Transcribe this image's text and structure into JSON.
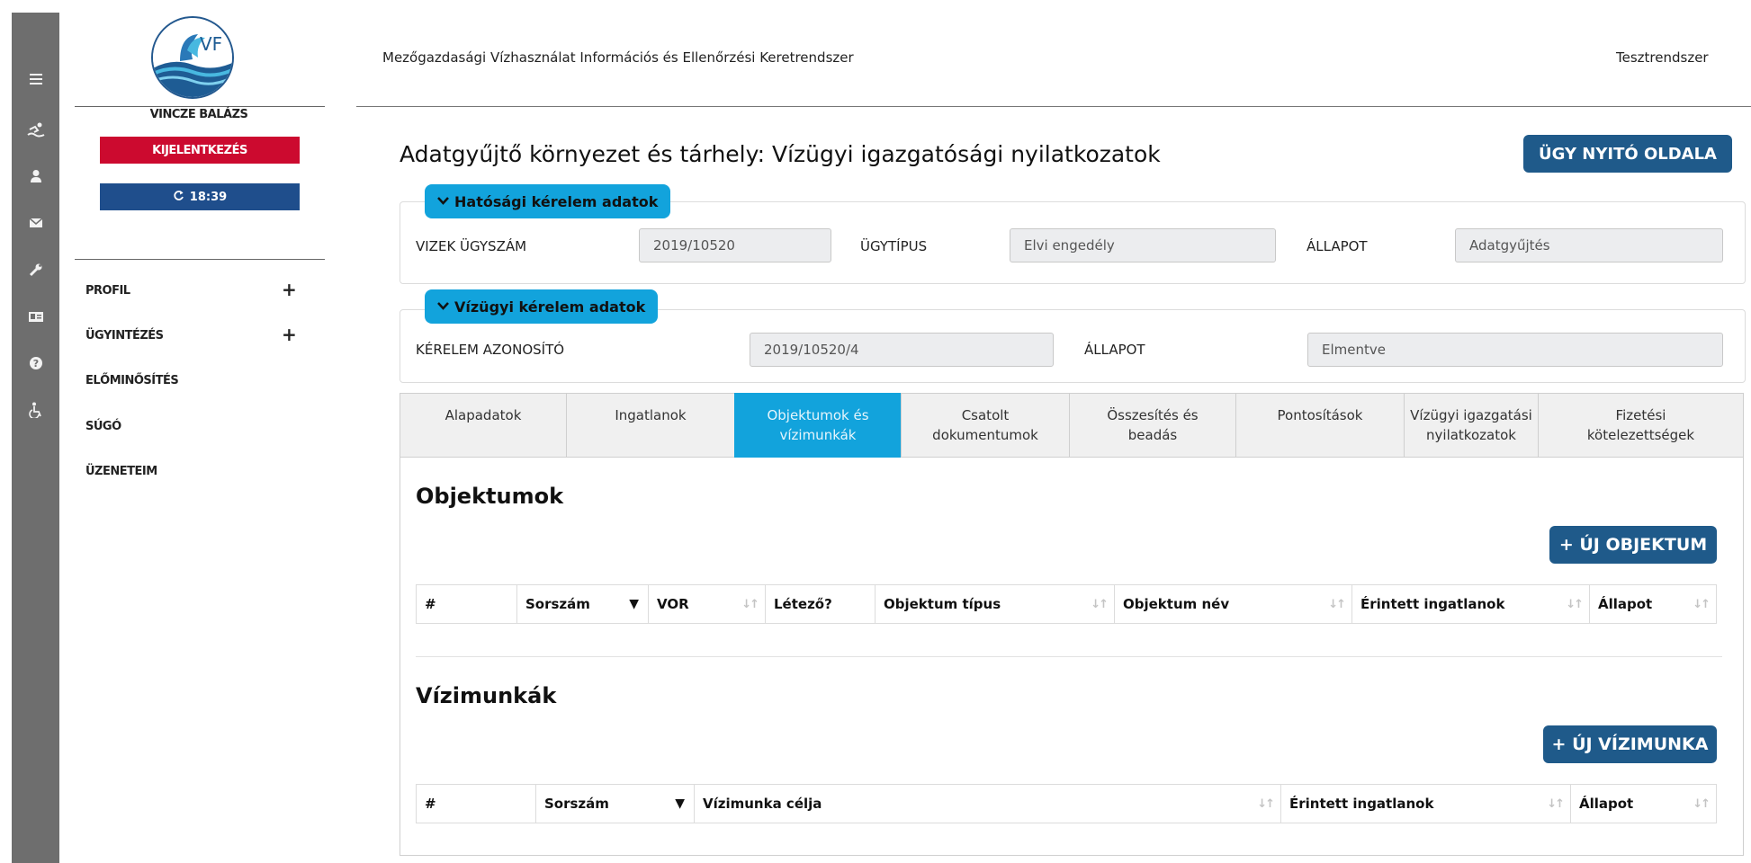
{
  "rail": {
    "icons": [
      "menu-icon",
      "swimmer-icon",
      "user-icon",
      "envelope-icon",
      "wrench-icon",
      "id-card-icon",
      "help-icon",
      "wheelchair-icon"
    ]
  },
  "sidebar": {
    "user_name": "VINCZE BALÁZS",
    "logout_label": "KIJELENTKEZÉS",
    "timer": "18:39",
    "menu": [
      {
        "label": "PROFIL",
        "expand": "+"
      },
      {
        "label": "ÜGYINTÉZÉS",
        "expand": "+"
      },
      {
        "label": "ELŐMINŐSÍTÉS"
      },
      {
        "label": "SÚGÓ"
      },
      {
        "label": "ÜZENETEIM"
      }
    ]
  },
  "header": {
    "app_title": "Mezőgazdasági Vízhasználat Információs és Ellenőrzési Keretrendszer",
    "environment": "Tesztrendszer"
  },
  "page": {
    "title": "Adatgyűjtő környezet és tárhely: Vízügyi igazgatósági nyilatkozatok",
    "case_open_button": "ÜGY NYITÓ OLDALA"
  },
  "authority_panel": {
    "legend": "Hatósági kérelem adatok",
    "case_number_label": "VIZEK ÜGYSZÁM",
    "case_number_value": "2019/10520",
    "case_type_label": "ÜGYTÍPUS",
    "case_type_value": "Elvi engedély",
    "status_label": "ÁLLAPOT",
    "status_value": "Adatgyűjtés"
  },
  "water_panel": {
    "legend": "Vízügyi kérelem adatok",
    "request_id_label": "KÉRELEM AZONOSÍTÓ",
    "request_id_value": "2019/10520/4",
    "status_label": "ÁLLAPOT",
    "status_value": "Elmentve"
  },
  "tabs": [
    {
      "line1": "Alapadatok",
      "line2": ""
    },
    {
      "line1": "Ingatlanok",
      "line2": ""
    },
    {
      "line1": "Objektumok és",
      "line2": "vízimunkák"
    },
    {
      "line1": "Csatolt",
      "line2": "dokumentumok"
    },
    {
      "line1": "Összesítés és",
      "line2": "beadás"
    },
    {
      "line1": "Pontosítások",
      "line2": ""
    },
    {
      "line1": "Vízügyi igazgatási",
      "line2": "nyilatkozatok"
    },
    {
      "line1": "Fizetési",
      "line2": "kötelezettségek"
    }
  ],
  "objects": {
    "title": "Objektumok",
    "new_button": "+ ÚJ OBJEKTUM",
    "columns": [
      "#",
      "Sorszám",
      "VOR",
      "Létező?",
      "Objektum típus",
      "Objektum név",
      "Érintett ingatlanok",
      "Állapot"
    ]
  },
  "works": {
    "title": "Vízimunkák",
    "new_button": "+ ÚJ VÍZIMUNKA",
    "columns": [
      "#",
      "Sorszám",
      "Vízimunka célja",
      "Érintett ingatlanok",
      "Állapot"
    ]
  },
  "colors": {
    "accent": "#12a3dc",
    "primary": "#1f5a8a",
    "danger": "#cc0a2f",
    "rail": "#6e6e6e"
  }
}
